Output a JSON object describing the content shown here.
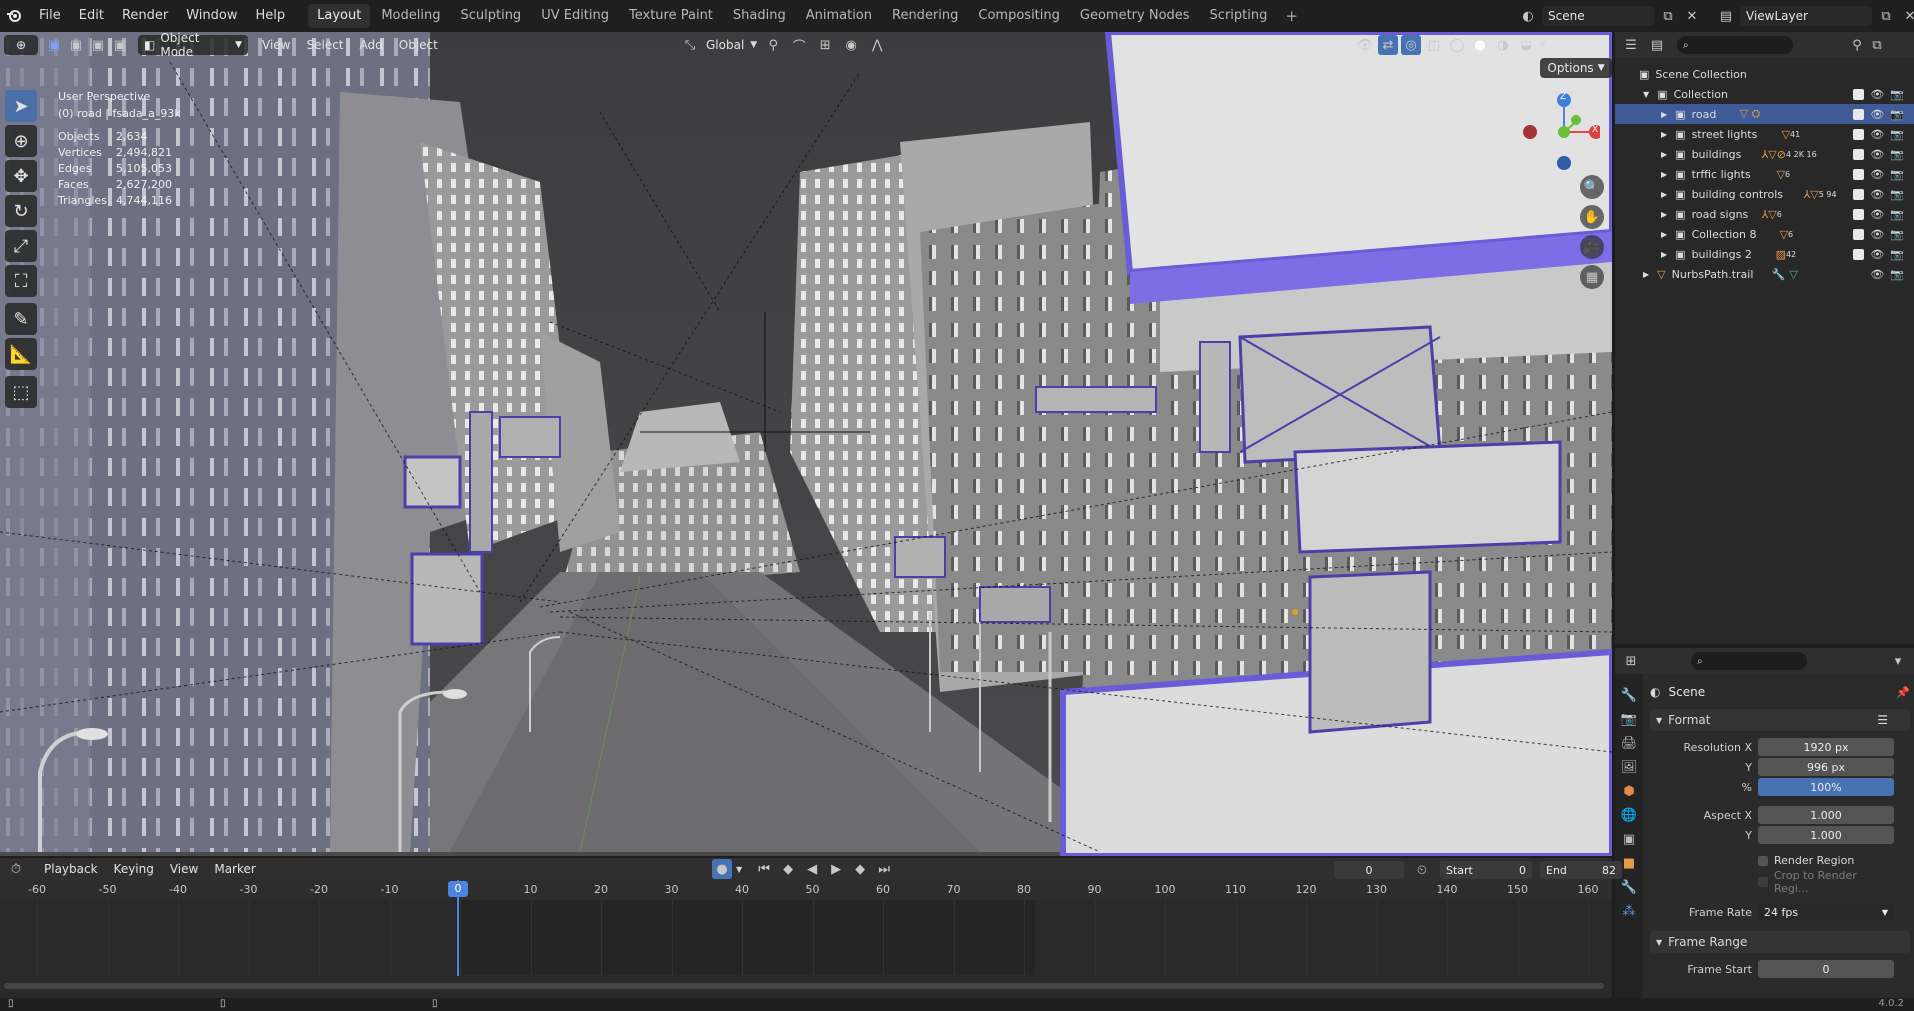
{
  "topbar": {
    "menus": [
      "File",
      "Edit",
      "Render",
      "Window",
      "Help"
    ],
    "workspaces": [
      "Layout",
      "Modeling",
      "Sculpting",
      "UV Editing",
      "Texture Paint",
      "Shading",
      "Animation",
      "Rendering",
      "Compositing",
      "Geometry Nodes",
      "Scripting"
    ],
    "active_workspace": "Layout",
    "add_symbol": "+",
    "scene": "Scene",
    "view_layer": "ViewLayer"
  },
  "viewport": {
    "mode": "Object Mode",
    "menus": [
      "View",
      "Select",
      "Add",
      "Object"
    ],
    "orientation": "Global",
    "options_label": "Options",
    "perspective": "User Perspective",
    "active_object": "(0) road | fsada_a_93k",
    "stats": [
      {
        "label": "Objects",
        "value": "2,634"
      },
      {
        "label": "Vertices",
        "value": "2,494,821"
      },
      {
        "label": "Edges",
        "value": "5,105,053"
      },
      {
        "label": "Faces",
        "value": "2,627,200"
      },
      {
        "label": "Triangles",
        "value": "4,744,116"
      }
    ],
    "gizmo": {
      "z": "Z",
      "x": "X"
    }
  },
  "outliner": {
    "root": "Scene Collection",
    "collection": "Collection",
    "items": [
      {
        "label": "road",
        "badge": "",
        "selected": true
      },
      {
        "label": "street lights",
        "badge": "41",
        "selected": false
      },
      {
        "label": "buildings",
        "badge": "4  2K  16",
        "selected": false
      },
      {
        "label": "trffic lights",
        "badge": "6",
        "selected": false
      },
      {
        "label": "building controls",
        "badge": "5  94",
        "selected": false
      },
      {
        "label": "road signs",
        "badge": "6",
        "selected": false
      },
      {
        "label": "Collection 8",
        "badge": "6",
        "selected": false
      },
      {
        "label": "buildings 2",
        "badge": "42",
        "selected": false
      }
    ],
    "extra": "NurbsPath.trail"
  },
  "properties": {
    "context": "Scene",
    "format_panel": "Format",
    "resolution_x_label": "Resolution X",
    "resolution_x": "1920 px",
    "resolution_y_label": "Y",
    "resolution_y": "996 px",
    "percent_label": "%",
    "percent": "100%",
    "aspect_x_label": "Aspect X",
    "aspect_x": "1.000",
    "aspect_y_label": "Y",
    "aspect_y": "1.000",
    "render_region": "Render Region",
    "crop_region": "Crop to Render Regi...",
    "frame_rate_label": "Frame Rate",
    "frame_rate": "24 fps",
    "frame_range_panel": "Frame Range",
    "frame_start_label": "Frame Start",
    "frame_start": "0"
  },
  "timeline": {
    "menus": [
      "Playback",
      "Keying",
      "View",
      "Marker"
    ],
    "current_frame": "0",
    "start_label": "Start",
    "start": "0",
    "end_label": "End",
    "end": "82",
    "ticks": [
      "-60",
      "-50",
      "-40",
      "-30",
      "-20",
      "-10",
      "0",
      "10",
      "20",
      "30",
      "40",
      "50",
      "60",
      "70",
      "80",
      "90",
      "100",
      "110",
      "120",
      "130",
      "140",
      "150",
      "160"
    ],
    "current_marker": "0"
  },
  "statusbar": {
    "version": "4.0.2"
  }
}
